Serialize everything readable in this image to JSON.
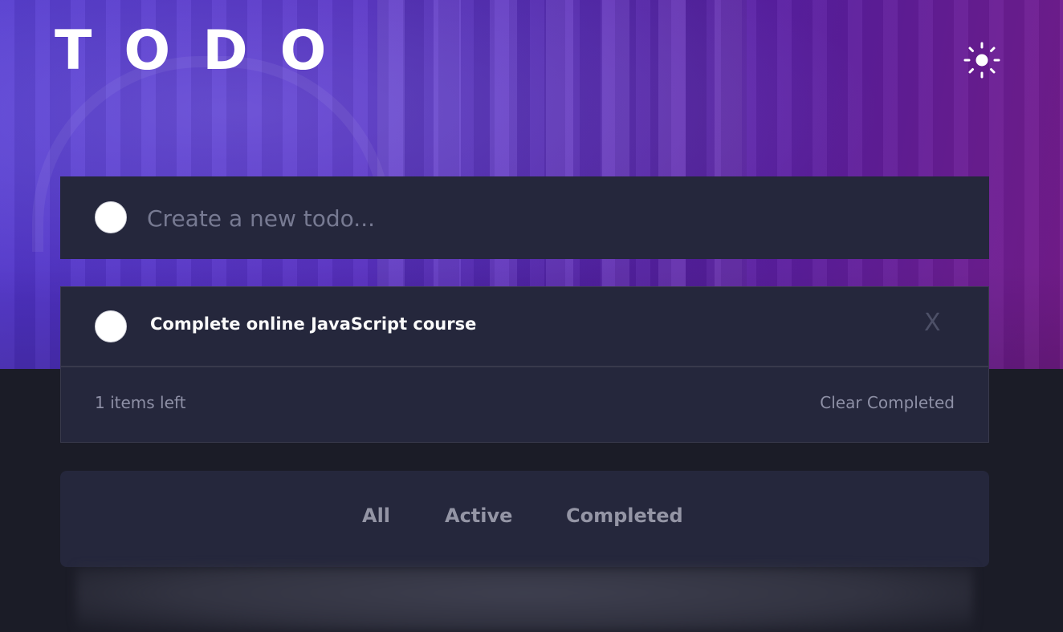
{
  "app": {
    "title": "TODO"
  },
  "theme_toggle": {
    "icon": "sun-icon"
  },
  "new_todo": {
    "placeholder": "Create a new todo..."
  },
  "todos": [
    {
      "text": "Complete online JavaScript course",
      "completed": false,
      "delete_label": "X"
    }
  ],
  "footer": {
    "items_left": "1 items left",
    "clear_label": "Clear Completed"
  },
  "filters": [
    "All",
    "Active",
    "Completed"
  ],
  "colors": {
    "background": "#1b1c27",
    "card": "#25273c",
    "text": "#fafafa",
    "muted": "#8e90a6",
    "hero_start": "#4f34c9",
    "hero_end": "#761c8c"
  }
}
